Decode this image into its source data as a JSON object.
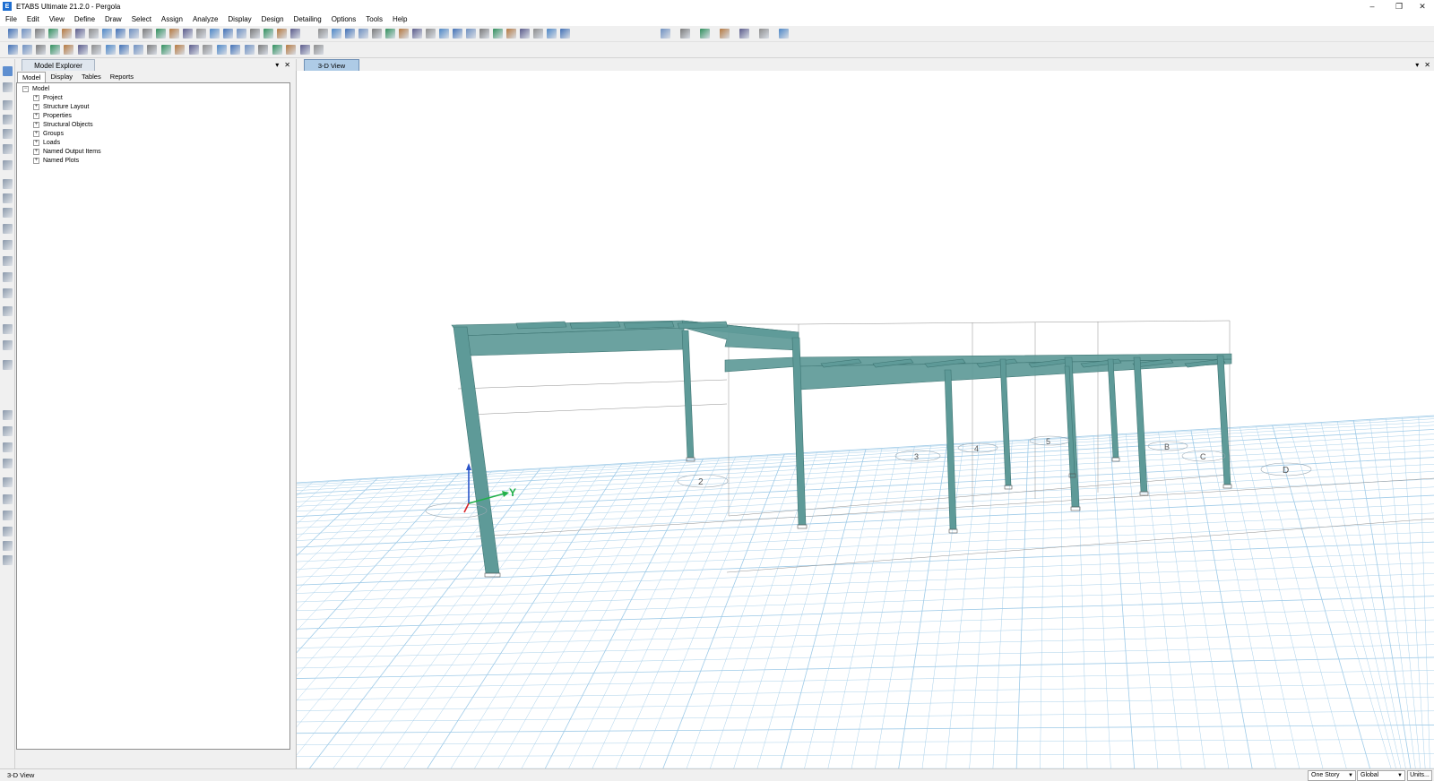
{
  "window": {
    "title": "ETABS Ultimate 21.2.0 - Pergola",
    "logo_letter": "E",
    "min": "–",
    "max": "❐",
    "close": "✕"
  },
  "menu": [
    "File",
    "Edit",
    "View",
    "Define",
    "Draw",
    "Select",
    "Assign",
    "Analyze",
    "Display",
    "Design",
    "Detailing",
    "Options",
    "Tools",
    "Help"
  ],
  "explorer": {
    "title": "Model Explorer",
    "pin": "▾",
    "close": "✕",
    "tabs": [
      "Model",
      "Display",
      "Tables",
      "Reports"
    ],
    "root": "Model",
    "items": [
      "Project",
      "Structure Layout",
      "Properties",
      "Structural Objects",
      "Groups",
      "Loads",
      "Named Output Items",
      "Named Plots"
    ]
  },
  "viewport": {
    "tab": "3-D View",
    "pin": "▾",
    "close": "✕",
    "axis_y": "Y",
    "grid_labels": [
      "2",
      "3",
      "4",
      "5",
      "B",
      "C",
      "D"
    ]
  },
  "status": {
    "left": "3-D View",
    "story": "One Story",
    "coord": "Global",
    "units": "Units..."
  },
  "colors": {
    "member": "#5e9a98",
    "member_dark": "#3f7674",
    "grid": "#9fcbe8",
    "accent": "#1f6fd1"
  }
}
